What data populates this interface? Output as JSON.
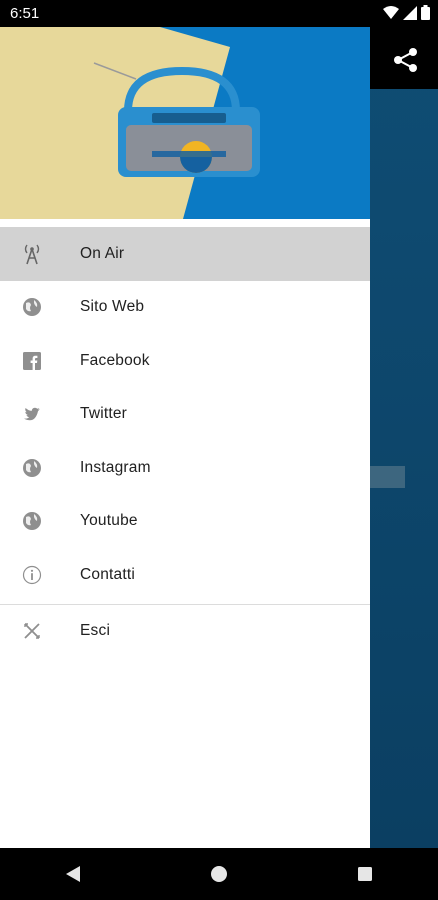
{
  "status": {
    "time": "6:51"
  },
  "menu": [
    {
      "label": "On Air",
      "icon": "radio-tower-icon",
      "active": true
    },
    {
      "label": "Sito Web",
      "icon": "globe-icon"
    },
    {
      "label": "Facebook",
      "icon": "facebook-icon"
    },
    {
      "label": "Twitter",
      "icon": "twitter-icon"
    },
    {
      "label": "Instagram",
      "icon": "globe-icon"
    },
    {
      "label": "Youtube",
      "icon": "globe-icon"
    },
    {
      "label": "Contatti",
      "icon": "info-icon"
    }
  ],
  "exit_item": {
    "label": "Esci",
    "icon": "close-x-icon"
  },
  "colors": {
    "header_beige": "#e7d89a",
    "header_blue": "#0b7ac4",
    "active_row": "#d2d2d2",
    "app_bg": "#0e4a70"
  }
}
